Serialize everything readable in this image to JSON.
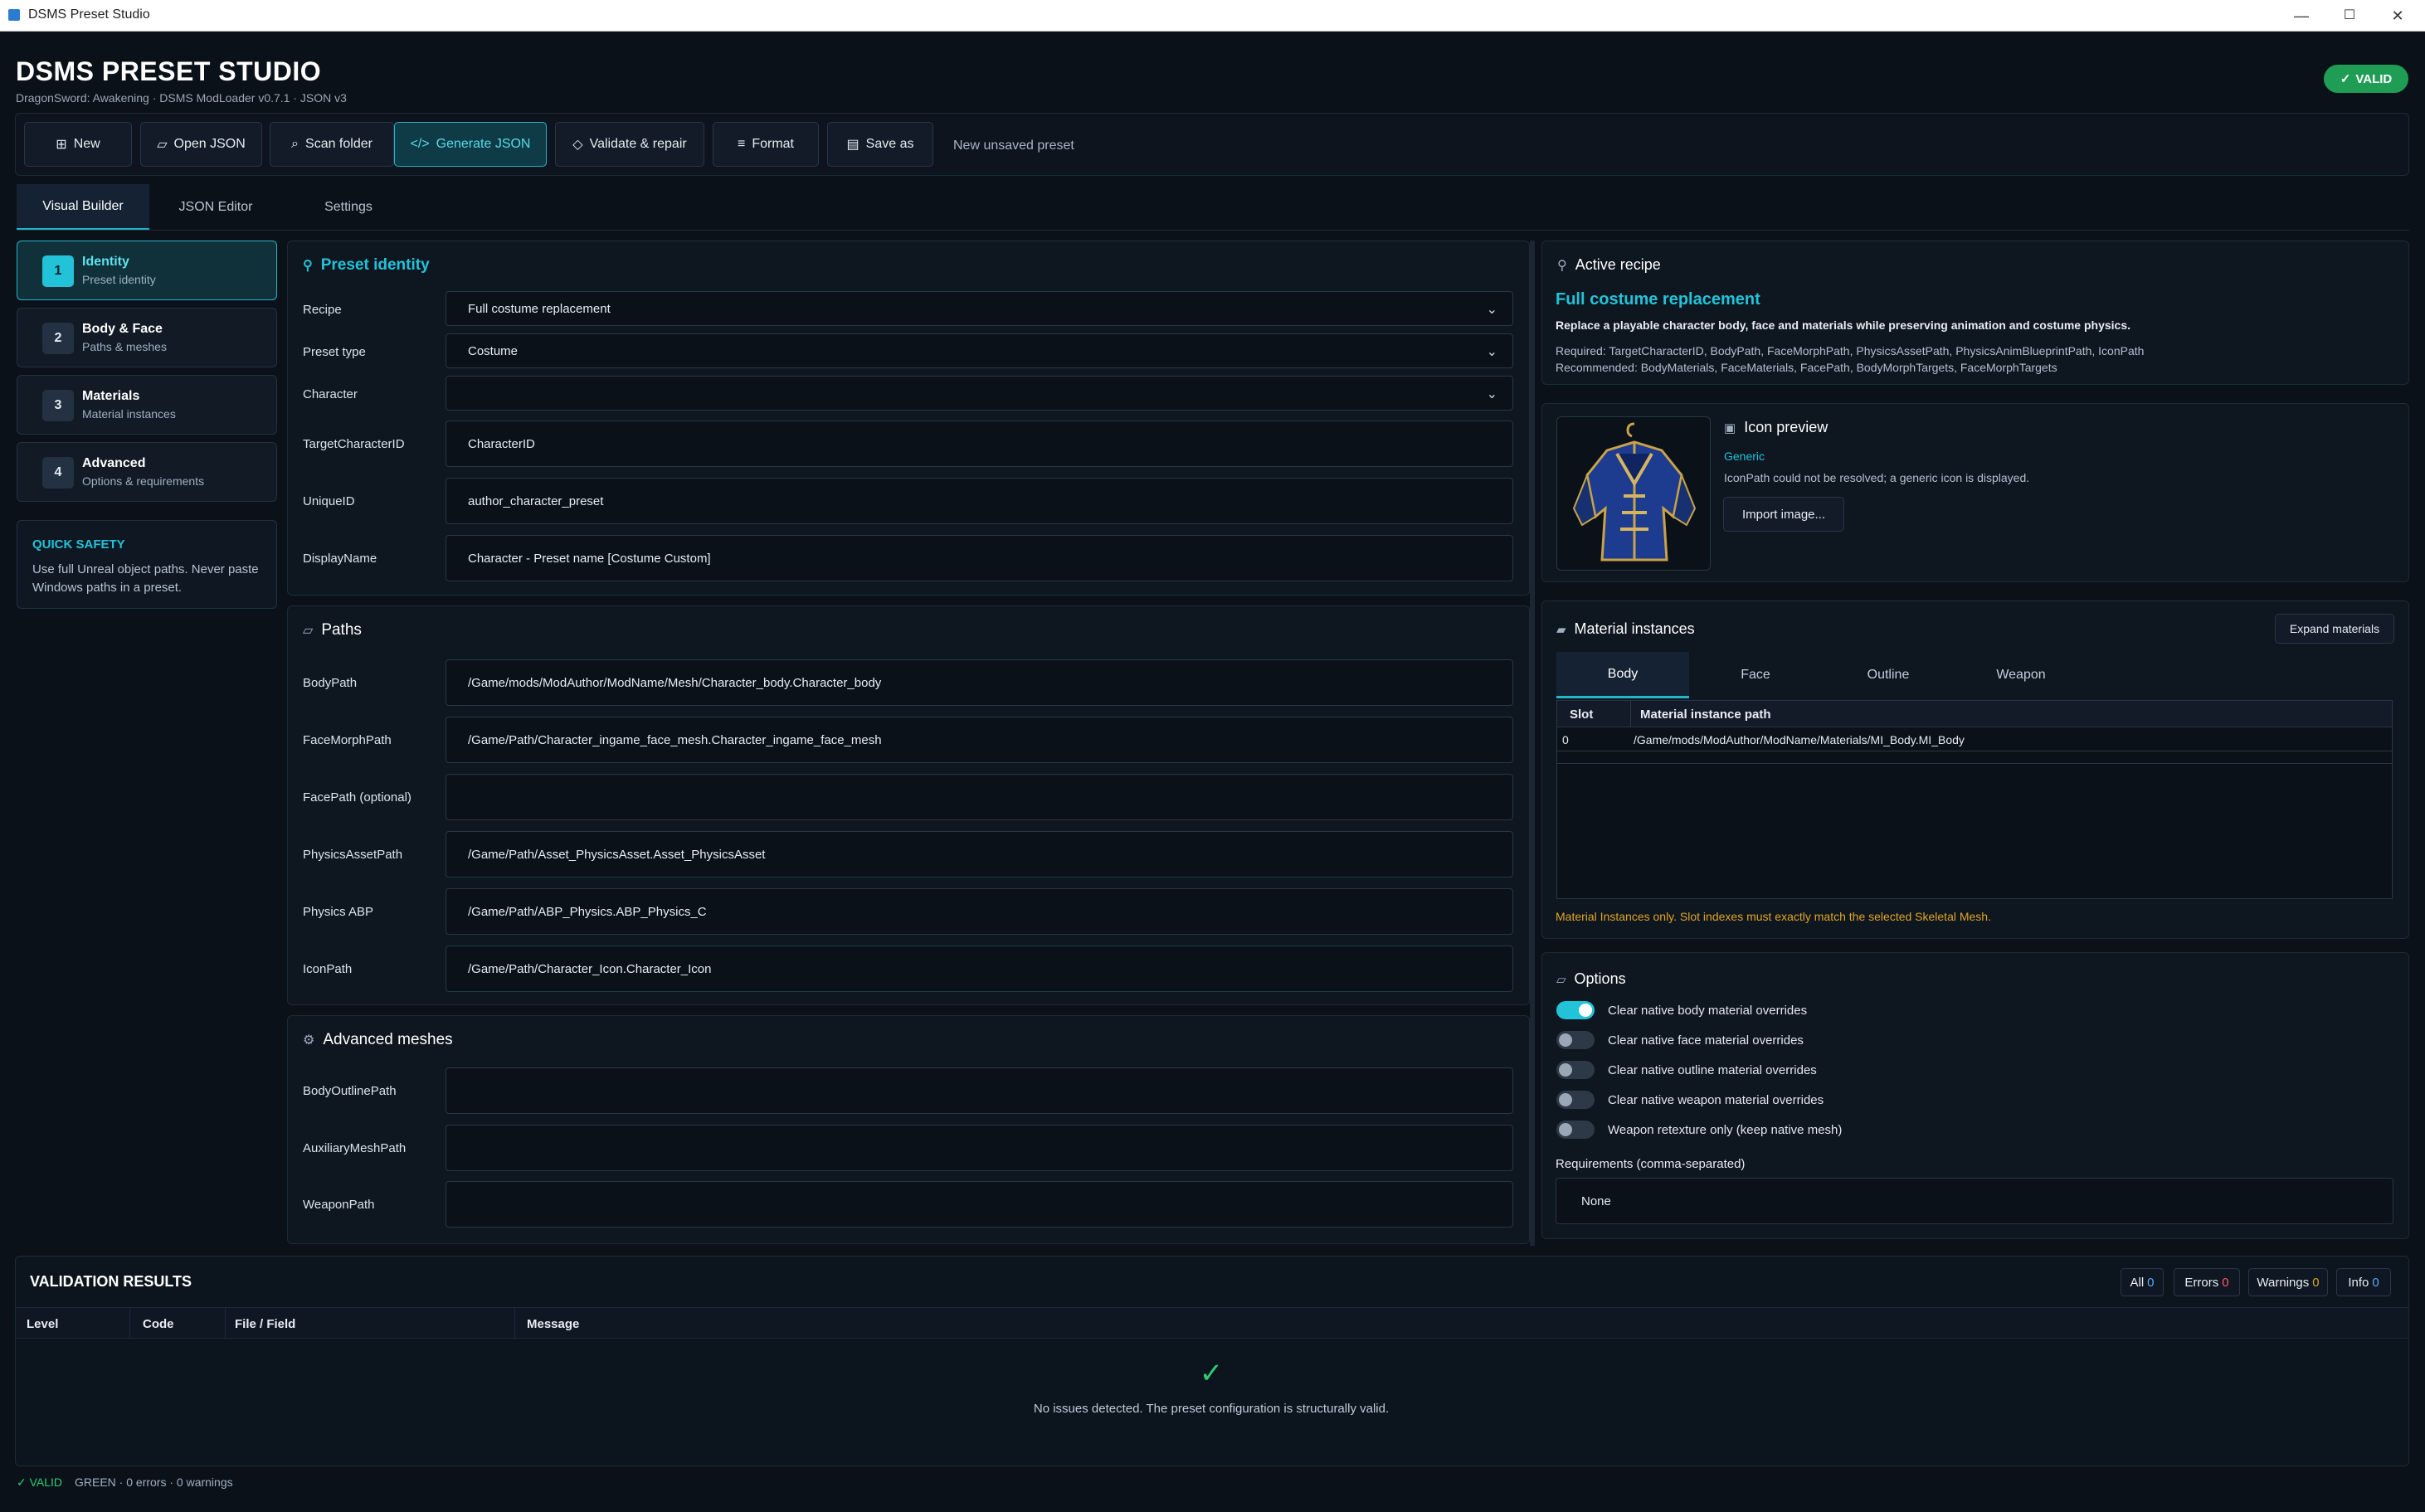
{
  "window": {
    "title": "DSMS Preset Studio",
    "minimize": "—",
    "maximize": "☐",
    "close": "✕"
  },
  "header": {
    "title": "DSMS PRESET STUDIO",
    "subtitle": "DragonSword: Awakening · DSMS ModLoader v0.7.1 · JSON v3",
    "badge": "VALID",
    "badge_icon": "✓"
  },
  "toolbar": {
    "buttons": [
      {
        "icon": "⊞",
        "label": "New"
      },
      {
        "icon": "▱",
        "label": "Open JSON"
      },
      {
        "icon": "⌕",
        "label": "Scan folder"
      },
      {
        "icon": "</>",
        "label": "Generate JSON"
      },
      {
        "icon": "◇",
        "label": "Validate & repair"
      },
      {
        "icon": "≡",
        "label": "Format"
      },
      {
        "icon": "▤",
        "label": "Save as"
      }
    ],
    "status": "New unsaved preset"
  },
  "tabs": [
    "Visual Builder",
    "JSON Editor",
    "Settings"
  ],
  "steps": [
    {
      "num": "1",
      "title": "Identity",
      "sub": "Preset identity"
    },
    {
      "num": "2",
      "title": "Body & Face",
      "sub": "Paths & meshes"
    },
    {
      "num": "3",
      "title": "Materials",
      "sub": "Material instances"
    },
    {
      "num": "4",
      "title": "Advanced",
      "sub": "Options & requirements"
    }
  ],
  "quick_safety": {
    "heading": "QUICK SAFETY",
    "body": "Use full Unreal object paths. Never paste Windows paths in a preset."
  },
  "identity": {
    "heading": "Preset identity",
    "fields": [
      {
        "label": "Recipe",
        "value": "Full costume replacement"
      },
      {
        "label": "Preset type",
        "value": "Costume"
      },
      {
        "label": "Character",
        "value": ""
      },
      {
        "label": "TargetCharacterID",
        "value": "CharacterID"
      },
      {
        "label": "UniqueID",
        "value": "author_character_preset"
      },
      {
        "label": "DisplayName",
        "value": "Character - Preset name [Costume Custom]"
      }
    ]
  },
  "paths": {
    "heading": "Paths",
    "fields": [
      {
        "label": "BodyPath",
        "value": "/Game/mods/ModAuthor/ModName/Mesh/Character_body.Character_body"
      },
      {
        "label": "FaceMorphPath",
        "value": "/Game/Path/Character_ingame_face_mesh.Character_ingame_face_mesh"
      },
      {
        "label": "FacePath (optional)",
        "value": ""
      },
      {
        "label": "PhysicsAssetPath",
        "value": "/Game/Path/Asset_PhysicsAsset.Asset_PhysicsAsset"
      },
      {
        "label": "Physics ABP",
        "value": "/Game/Path/ABP_Physics.ABP_Physics_C"
      },
      {
        "label": "IconPath",
        "value": "/Game/Path/Character_Icon.Character_Icon"
      }
    ]
  },
  "advanced": {
    "heading": "Advanced meshes",
    "fields": [
      {
        "label": "BodyOutlinePath",
        "value": ""
      },
      {
        "label": "AuxiliaryMeshPath",
        "value": ""
      },
      {
        "label": "WeaponPath",
        "value": ""
      }
    ]
  },
  "recipe": {
    "heading": "Active recipe",
    "name": "Full costume replacement",
    "description": "Replace a playable character body, face and materials while preserving animation and costume physics.",
    "required": "Required: TargetCharacterID, BodyPath, FaceMorphPath, PhysicsAssetPath, PhysicsAnimBlueprintPath, IconPath",
    "recommended": "Recommended: BodyMaterials, FaceMaterials, FacePath, BodyMorphTargets, FaceMorphTargets"
  },
  "icon_preview": {
    "heading": "Icon preview",
    "kind": "Generic",
    "message": "IconPath could not be resolved; a generic icon is displayed.",
    "button": "Import image..."
  },
  "materials": {
    "heading": "Material instances",
    "expand_button": "Expand materials",
    "tabs": [
      "Body",
      "Face",
      "Outline",
      "Weapon"
    ],
    "columns": [
      "Slot",
      "Material instance path"
    ],
    "rows": [
      {
        "slot": "0",
        "path": "/Game/mods/ModAuthor/ModName/Materials/MI_Body.MI_Body"
      }
    ],
    "note": "Material Instances only. Slot indexes must exactly match the selected Skeletal Mesh.",
    "note_color": "#e0a526"
  },
  "options": {
    "heading": "Options",
    "toggles": [
      {
        "label": "Clear native body material overrides",
        "on": true
      },
      {
        "label": "Clear native face material overrides",
        "on": false
      },
      {
        "label": "Clear native outline material overrides",
        "on": false
      },
      {
        "label": "Clear native weapon material overrides",
        "on": false
      },
      {
        "label": "Weapon retexture only (keep native mesh)",
        "on": false
      }
    ],
    "requirements_label": "Requirements (comma-separated)",
    "requirements_value": "None"
  },
  "validation": {
    "heading": "VALIDATION RESULTS",
    "filters": [
      {
        "label": "All",
        "count": "0",
        "color": "#5aa9ff"
      },
      {
        "label": "Errors",
        "count": "0",
        "color": "#ff5a5a"
      },
      {
        "label": "Warnings",
        "count": "0",
        "color": "#e0a526"
      },
      {
        "label": "Info",
        "count": "0",
        "color": "#5aa9ff"
      }
    ],
    "columns": [
      "Level",
      "Code",
      "File / Field",
      "Message"
    ],
    "empty_icon": "✓",
    "empty_message": "No issues detected. The preset configuration is structurally valid."
  },
  "statusbar": {
    "valid": "✓ VALID",
    "summary": "GREEN · 0 errors · 0 warnings"
  },
  "colors": {
    "accent": "#22c3d8",
    "valid_green": "#1f9d55",
    "background": "#0b1119"
  }
}
